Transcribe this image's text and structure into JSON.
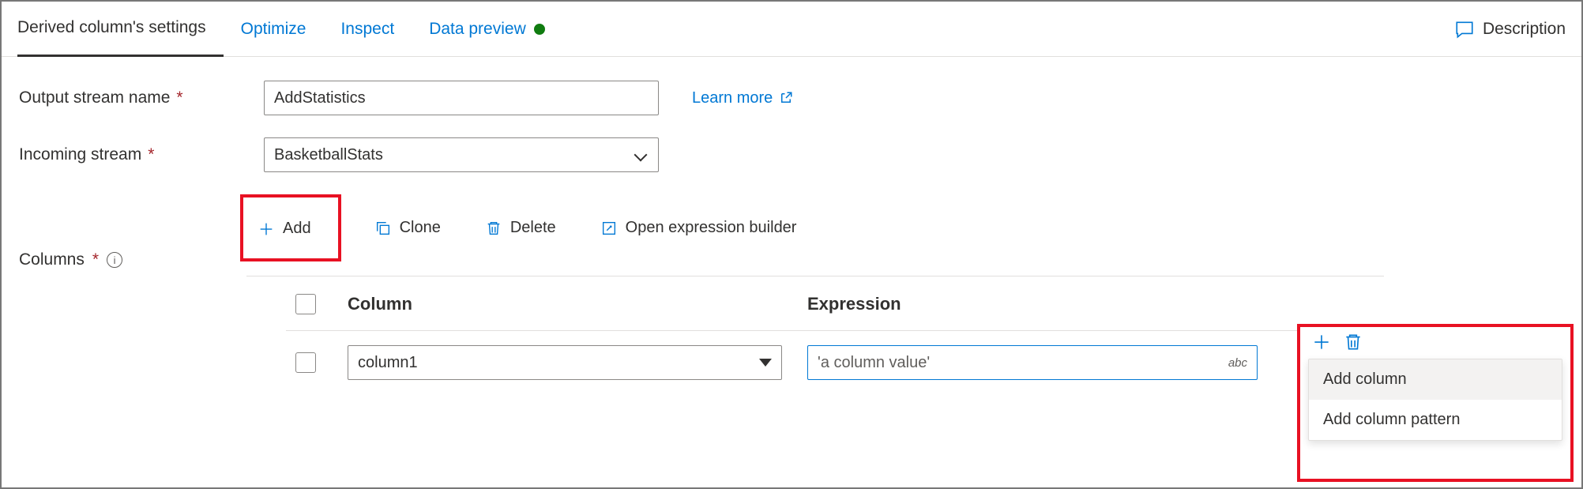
{
  "tabs": {
    "settings": "Derived column's settings",
    "optimize": "Optimize",
    "inspect": "Inspect",
    "preview": "Data preview"
  },
  "description_label": "Description",
  "form": {
    "output_stream_label": "Output stream name",
    "output_stream_value": "AddStatistics",
    "incoming_stream_label": "Incoming stream",
    "incoming_stream_value": "BasketballStats",
    "learn_more": "Learn more",
    "columns_label": "Columns"
  },
  "toolbar": {
    "add": "Add",
    "clone": "Clone",
    "delete": "Delete",
    "open_builder": "Open expression builder"
  },
  "grid": {
    "col_header": "Column",
    "expr_header": "Expression",
    "row": {
      "column_value": "column1",
      "expr_placeholder": "'a column value'",
      "type_hint": "abc"
    }
  },
  "menu": {
    "add_column": "Add column",
    "add_pattern": "Add column pattern"
  }
}
